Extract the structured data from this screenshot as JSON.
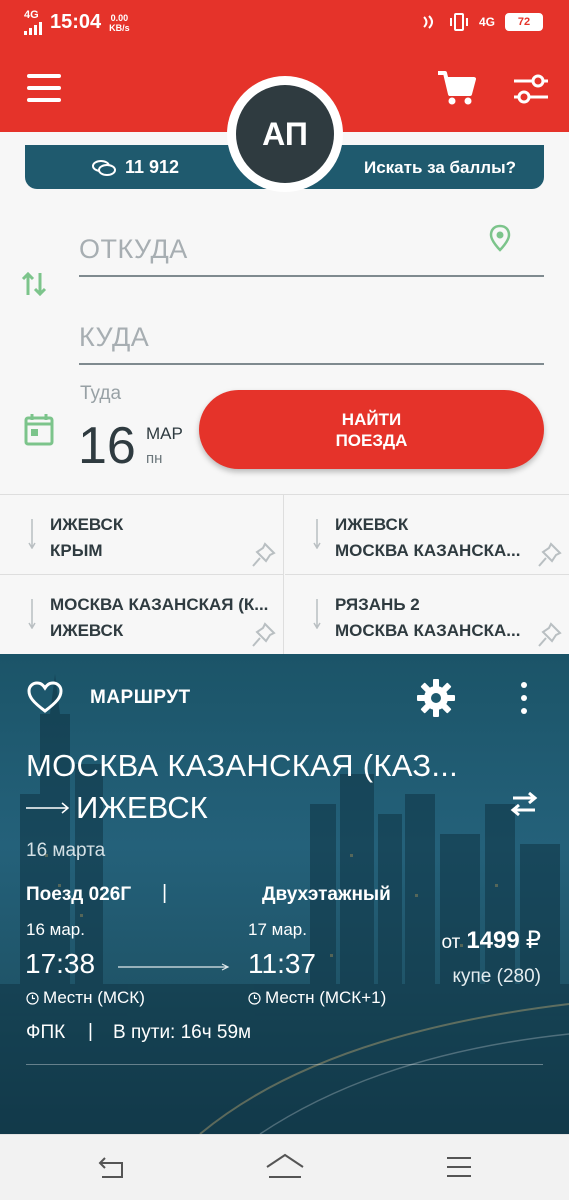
{
  "status_bar": {
    "network_left": "4G",
    "time": "15:04",
    "speed_value": "0.00",
    "speed_unit": "KB/s",
    "network_right": "4G",
    "battery": "72"
  },
  "header": {
    "avatar_initials": "АП",
    "points_value": "11 912",
    "search_for_points": "Искать за баллы?"
  },
  "search_form": {
    "from_placeholder": "ОТКУДА",
    "to_placeholder": "КУДА",
    "date_label": "Туда",
    "date_day": "16",
    "date_month": "МАР",
    "date_weekday": "пн",
    "find_button": "НАЙТИ\nПОЕЗДА"
  },
  "recent_routes": [
    {
      "from": "ИЖЕВСК",
      "to": "КРЫМ"
    },
    {
      "from": "ИЖЕВСК",
      "to": "МОСКВА КАЗАНСКА..."
    },
    {
      "from": "МОСКВА КАЗАНСКАЯ (К...",
      "to": "ИЖЕВСК"
    },
    {
      "from": "РЯЗАНЬ 2",
      "to": "МОСКВА КАЗАНСКА..."
    }
  ],
  "route_card": {
    "title": "МАРШРУТ",
    "from_station": "МОСКВА КАЗАНСКАЯ (КАЗ...",
    "to_station": "ИЖЕВСК",
    "date": "16 марта",
    "train_number": "Поезд 026Г",
    "train_sep": "|",
    "train_type": "Двухэтажный",
    "departure_date": "16 мар.",
    "departure_time": "17:38",
    "departure_zone": "Местн (МСК)",
    "arrival_date": "17 мар.",
    "arrival_time": "11:37",
    "arrival_zone": "Местн (МСК+1)",
    "price_prefix": "от",
    "price_value": "1499",
    "price_currency": "₽",
    "seat_class": "купе (280)",
    "carrier": "ФПК",
    "carrier_sep": "|",
    "duration": "В пути: 16ч 59м"
  },
  "colors": {
    "brand_red": "#e5332a",
    "teal": "#1f5a6e",
    "green_icon": "#7cc48b",
    "dark_text": "#2f3b40"
  }
}
